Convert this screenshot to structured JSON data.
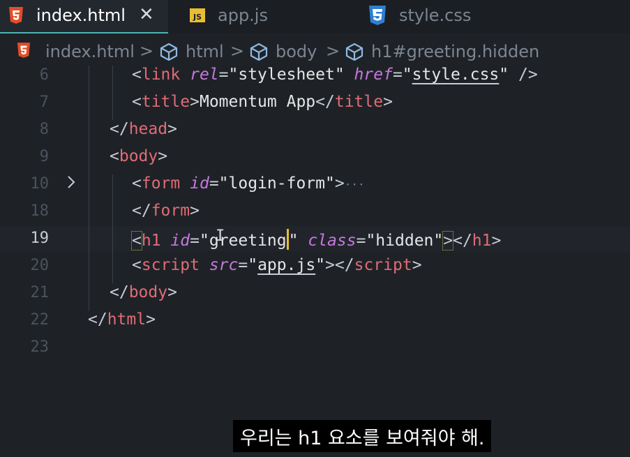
{
  "tabs": [
    {
      "label": "index.html",
      "icon": "html5-icon",
      "active": true
    },
    {
      "label": "app.js",
      "icon": "js-icon",
      "active": false
    },
    {
      "label": "style.css",
      "icon": "css3-icon",
      "active": false
    }
  ],
  "tab_close_glyph": "✕",
  "breadcrumb": {
    "file": "index.html",
    "items": [
      "html",
      "body",
      "h1#greeting.hidden"
    ],
    "separator": ">"
  },
  "editor": {
    "current_line": 19,
    "lines": [
      {
        "num": "6",
        "link_open": "<",
        "link_tag": "link",
        "rel_attr": "rel",
        "rel_val": "\"stylesheet\"",
        "href_attr": "href",
        "href_q1": "\"",
        "href_val": "style.css",
        "href_q2": "\"",
        "self_close": "/>"
      },
      {
        "num": "7",
        "title_open": "<",
        "title_tag": "title",
        "title_gt": ">",
        "title_text": "Momentum App",
        "title_close_lt": "</",
        "title_close_tag": "title",
        "title_close_gt": ">"
      },
      {
        "num": "8",
        "lt": "</",
        "tag": "head",
        "gt": ">"
      },
      {
        "num": "9",
        "lt": "<",
        "tag": "body",
        "gt": ">"
      },
      {
        "num": "10",
        "lt": "<",
        "tag": "form",
        "id_attr": "id",
        "id_val": "\"login-form\"",
        "gt": ">",
        "fold": "···"
      },
      {
        "num": "18",
        "lt": "</",
        "tag": "form",
        "gt": ">"
      },
      {
        "num": "19",
        "lt": "<",
        "tag": "h1",
        "id_attr": "id",
        "q1": "\"",
        "id_val": "greeting",
        "q2": "\"",
        "class_attr": "class",
        "class_val": "\"hidden\"",
        "gt": ">",
        "close_lt": "</",
        "close_tag": "h1",
        "close_gt": ">"
      },
      {
        "num": "20",
        "lt": "<",
        "tag": "script",
        "src_attr": "src",
        "q1": "\"",
        "src_val": "app.js",
        "q2": "\"",
        "gt": ">",
        "close_lt": "</",
        "close_tag": "script",
        "close_gt": ">"
      },
      {
        "num": "21",
        "lt": "</",
        "tag": "body",
        "gt": ">"
      },
      {
        "num": "22",
        "lt": "</",
        "tag": "html",
        "gt": ">"
      },
      {
        "num": "23"
      }
    ]
  },
  "subtitle": "우리는 h1 요소를 보여줘야 해.",
  "colors": {
    "background": "#1e2227",
    "tag": "#e06c75",
    "attribute": "#c678dd",
    "string": "#e5e5e5",
    "active_tab_underline": "#4fb3b6",
    "cursor": "#e8bd32"
  }
}
